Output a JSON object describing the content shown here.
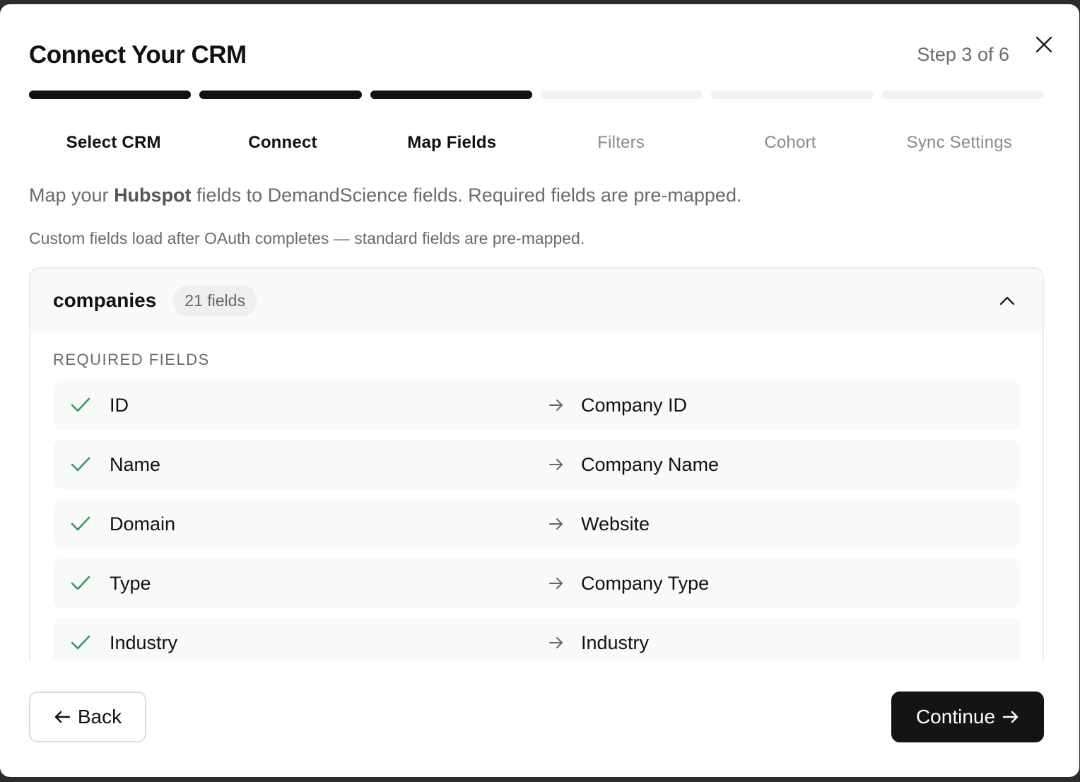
{
  "modal": {
    "title": "Connect Your CRM",
    "step_counter": "Step 3 of 6"
  },
  "progress": {
    "completed": 3,
    "total": 6
  },
  "steps": [
    {
      "label": "Select CRM",
      "state": "done"
    },
    {
      "label": "Connect",
      "state": "done"
    },
    {
      "label": "Map Fields",
      "state": "active"
    },
    {
      "label": "Filters",
      "state": "pending"
    },
    {
      "label": "Cohort",
      "state": "pending"
    },
    {
      "label": "Sync Settings",
      "state": "pending"
    }
  ],
  "intro": {
    "prefix": "Map your ",
    "crm": "Hubspot",
    "suffix": " fields to DemandScience fields. Required fields are pre-mapped."
  },
  "subnote": "Custom fields load after OAuth completes — standard fields are pre-mapped.",
  "panel": {
    "title": "companies",
    "count": "21 fields",
    "section_label": "REQUIRED FIELDS",
    "rows": [
      {
        "source": "ID",
        "target": "Company ID"
      },
      {
        "source": "Name",
        "target": "Company Name"
      },
      {
        "source": "Domain",
        "target": "Website"
      },
      {
        "source": "Type",
        "target": "Company Type"
      },
      {
        "source": "Industry",
        "target": "Industry"
      }
    ]
  },
  "footer": {
    "back_label": "Back",
    "continue_label": "Continue"
  },
  "colors": {
    "accent": "#141414",
    "check": "#2e9e5b",
    "muted_text": "#6b6b6b"
  },
  "icons": {
    "close": "close-icon",
    "collapse": "chevron-up-icon",
    "check": "check-icon",
    "map_arrow": "arrow-right-icon",
    "back": "arrow-left-icon",
    "continue": "arrow-right-icon"
  }
}
